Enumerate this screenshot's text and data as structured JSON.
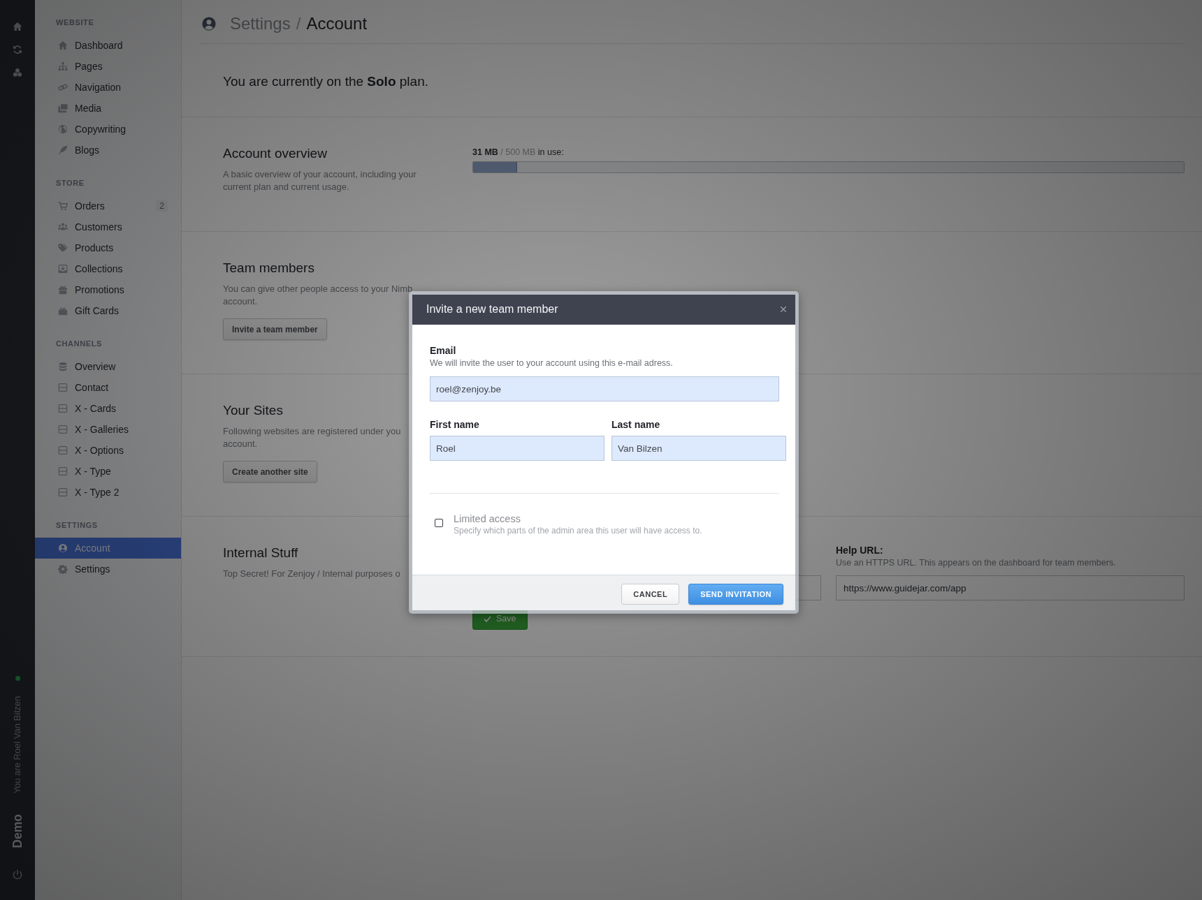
{
  "rail": {
    "online": true,
    "user_text": "You are Roel Van Bilzen",
    "site_name": "Demo"
  },
  "sidebar": {
    "sections": [
      {
        "title": "WEBSITE",
        "items": [
          {
            "label": "Dashboard",
            "selected": false
          },
          {
            "label": "Pages",
            "selected": false
          },
          {
            "label": "Navigation",
            "selected": false
          },
          {
            "label": "Media",
            "selected": false
          },
          {
            "label": "Copywriting",
            "selected": false
          },
          {
            "label": "Blogs",
            "selected": false
          }
        ]
      },
      {
        "title": "STORE",
        "items": [
          {
            "label": "Orders",
            "badge": "2",
            "selected": false
          },
          {
            "label": "Customers",
            "selected": false
          },
          {
            "label": "Products",
            "selected": false
          },
          {
            "label": "Collections",
            "selected": false
          },
          {
            "label": "Promotions",
            "selected": false
          },
          {
            "label": "Gift Cards",
            "selected": false
          }
        ]
      },
      {
        "title": "CHANNELS",
        "items": [
          {
            "label": "Overview",
            "selected": false
          },
          {
            "label": "Contact",
            "selected": false
          },
          {
            "label": "X - Cards",
            "selected": false
          },
          {
            "label": "X - Galleries",
            "selected": false
          },
          {
            "label": "X - Options",
            "selected": false
          },
          {
            "label": "X - Type",
            "selected": false
          },
          {
            "label": "X - Type 2",
            "selected": false
          }
        ]
      },
      {
        "title": "SETTINGS",
        "items": [
          {
            "label": "Account",
            "selected": true
          },
          {
            "label": "Settings",
            "selected": false
          }
        ]
      }
    ]
  },
  "header": {
    "parent": "Settings",
    "separator": "/",
    "current": "Account"
  },
  "plan_notice": "You are currently on the **Solo** plan.",
  "sections": [
    {
      "kind": "usage",
      "title": "Account overview",
      "description": [
        "A basic overview of your account, including your",
        "current plan and current usage."
      ],
      "usage": {
        "used": "31 MB",
        "total": "/ 500 MB",
        "suffix": "in use:",
        "level": 0.062
      }
    },
    {
      "kind": "action",
      "title": "Team members",
      "description": [
        "You can give other people access to your Nimb",
        "account."
      ],
      "button": "Invite a team member"
    },
    {
      "kind": "action",
      "title": "Your Sites",
      "description": [
        "Following websites are registered under you",
        "account."
      ],
      "button": "Create another site"
    },
    {
      "kind": "form",
      "title": "Internal Stuff",
      "description": [
        "Top Secret! For Zenjoy / Internal purposes o"
      ],
      "fields": [
        {
          "kind": "text"
        },
        {
          "kind": "text",
          "label": "Help URL:",
          "hint": "Use an HTTPS URL. This appears on the dashboard for team members.",
          "value": "https://www.guidejar.com/app"
        }
      ],
      "save_button": "Save"
    }
  ],
  "modal": {
    "title": "Invite a new team member",
    "email": {
      "label": "Email",
      "hint": "We will invite the user to your account using this e-mail adress.",
      "value": "roel@zenjoy.be"
    },
    "first_name": {
      "label": "First name",
      "value": "Roel"
    },
    "last_name": {
      "label": "Last name",
      "value": "Van Bilzen"
    },
    "limited_access": {
      "label": "Limited access",
      "hint": "Specify which parts of the admin area this user will have access to.",
      "checked": false
    },
    "buttons": [
      {
        "kind": "cancel",
        "label": "CANCEL"
      },
      {
        "kind": "submit",
        "label": "SEND INVITATION"
      }
    ]
  }
}
